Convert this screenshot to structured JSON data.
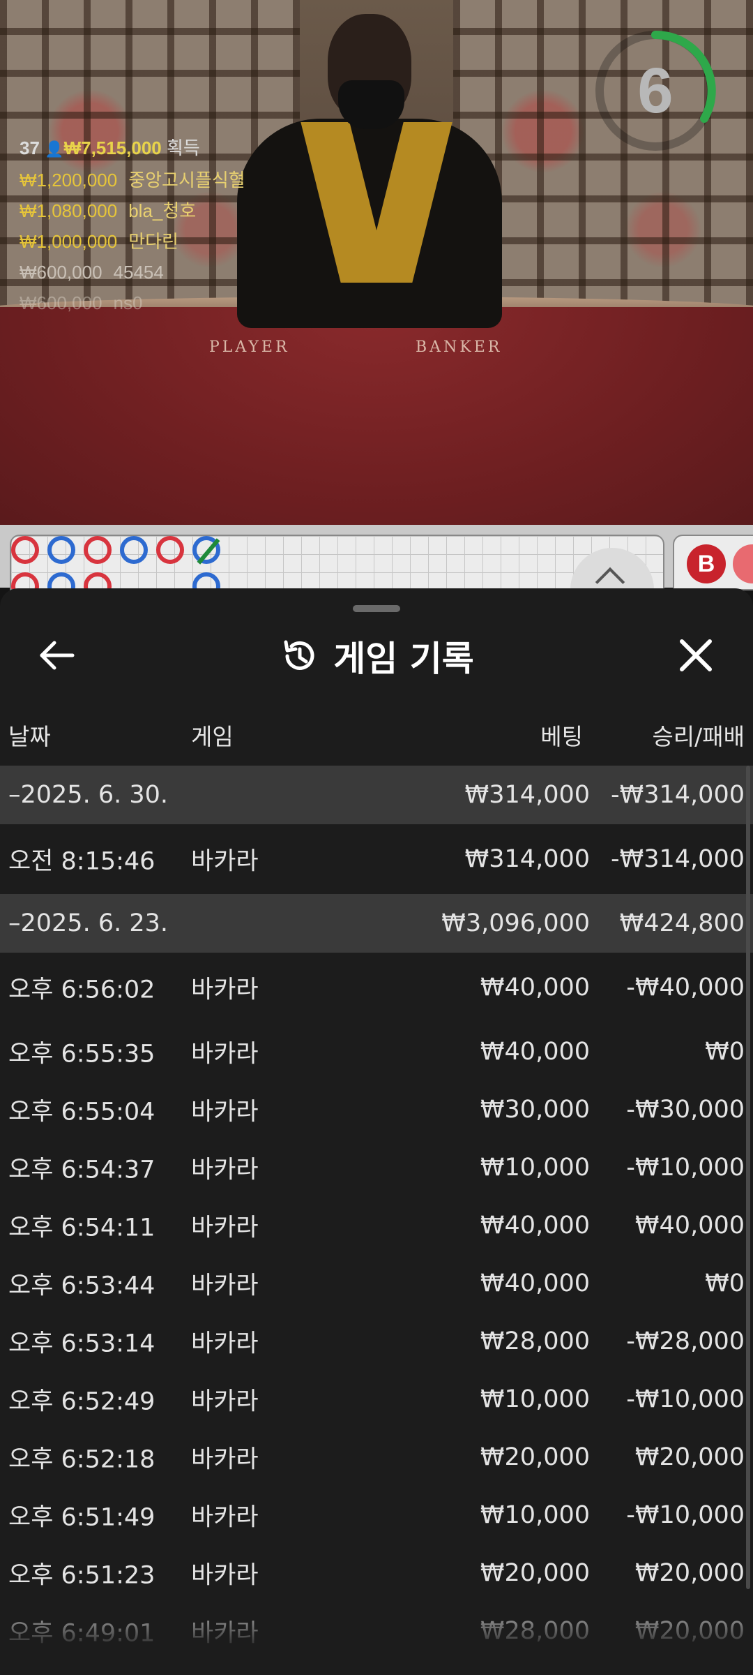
{
  "stream": {
    "timer_value": "6",
    "table_labels": [
      "PLAYER",
      "BANKER"
    ],
    "winners": {
      "count": "37",
      "total": "₩7,515,000",
      "label": "획득",
      "rows": [
        {
          "amount": "₩1,200,000",
          "name": "중앙고시플식혈"
        },
        {
          "amount": "₩1,080,000",
          "name": "bla_청호"
        },
        {
          "amount": "₩1,000,000",
          "name": "만다린"
        },
        {
          "amount": "₩600,000",
          "name": "45454"
        },
        {
          "amount": "₩600,000",
          "name": "ns0"
        }
      ]
    }
  },
  "road": {
    "b_label": "B"
  },
  "sheet": {
    "title": "게임 기록",
    "columns": {
      "date": "날짜",
      "game": "게임",
      "bet": "베팅",
      "winloss": "승리/패배"
    },
    "rows": [
      {
        "type": "group",
        "date": "–2025. 6. 30.",
        "game": "",
        "bet": "₩314,000",
        "winloss": "-₩314,000"
      },
      {
        "type": "entry",
        "date": "오전 8:15:46",
        "game": "바카라",
        "bet": "₩314,000",
        "winloss": "-₩314,000"
      },
      {
        "type": "group",
        "date": "–2025. 6. 23.",
        "game": "",
        "bet": "₩3,096,000",
        "winloss": "₩424,800"
      },
      {
        "type": "entry",
        "date": "오후 6:56:02",
        "game": "바카라",
        "bet": "₩40,000",
        "winloss": "-₩40,000"
      },
      {
        "type": "entry",
        "date": "오후 6:55:35",
        "game": "바카라",
        "bet": "₩40,000",
        "winloss": "₩0"
      },
      {
        "type": "entry",
        "date": "오후 6:55:04",
        "game": "바카라",
        "bet": "₩30,000",
        "winloss": "-₩30,000"
      },
      {
        "type": "entry",
        "date": "오후 6:54:37",
        "game": "바카라",
        "bet": "₩10,000",
        "winloss": "-₩10,000"
      },
      {
        "type": "entry",
        "date": "오후 6:54:11",
        "game": "바카라",
        "bet": "₩40,000",
        "winloss": "₩40,000"
      },
      {
        "type": "entry",
        "date": "오후 6:53:44",
        "game": "바카라",
        "bet": "₩40,000",
        "winloss": "₩0"
      },
      {
        "type": "entry",
        "date": "오후 6:53:14",
        "game": "바카라",
        "bet": "₩28,000",
        "winloss": "-₩28,000"
      },
      {
        "type": "entry",
        "date": "오후 6:52:49",
        "game": "바카라",
        "bet": "₩10,000",
        "winloss": "-₩10,000"
      },
      {
        "type": "entry",
        "date": "오후 6:52:18",
        "game": "바카라",
        "bet": "₩20,000",
        "winloss": "₩20,000"
      },
      {
        "type": "entry",
        "date": "오후 6:51:49",
        "game": "바카라",
        "bet": "₩10,000",
        "winloss": "-₩10,000"
      },
      {
        "type": "entry",
        "date": "오후 6:51:23",
        "game": "바카라",
        "bet": "₩20,000",
        "winloss": "₩20,000"
      },
      {
        "type": "entry",
        "date": "오후 6:49:01",
        "game": "바카라",
        "bet": "₩28,000",
        "winloss": "₩20,000"
      }
    ]
  },
  "colors": {
    "sheet_bg": "#1c1c1c",
    "group_row_bg": "#3a3a3a",
    "winner_gold": "#e6c53a",
    "timer_green": "#2ea84a",
    "road_red": "#d8343e",
    "road_blue": "#2d6ad0"
  }
}
